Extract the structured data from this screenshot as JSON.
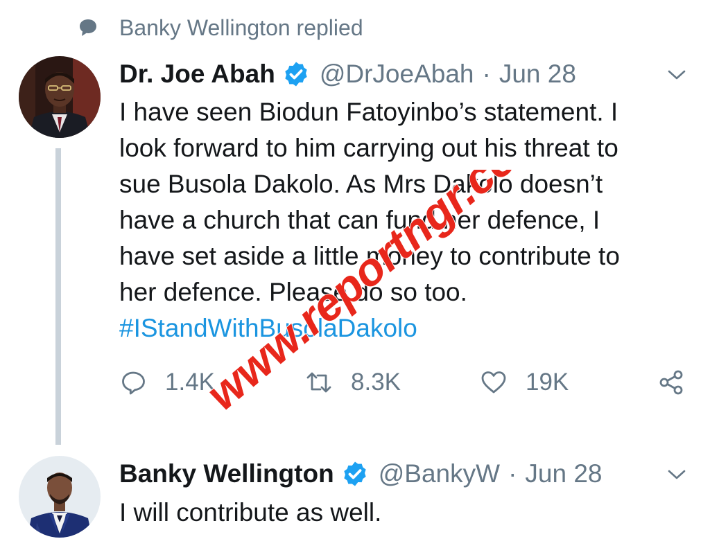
{
  "context": {
    "icon": "speech-bubble-icon",
    "text": "Banky Wellington replied"
  },
  "tweets": [
    {
      "author": {
        "name": "Dr. Joe Abah",
        "verified": true,
        "handle": "@DrJoeAbah"
      },
      "date": "Jun 28",
      "separator": "·",
      "lines": [
        "I have seen Biodun Fatoyinbo’s statement. I",
        "look forward to him carrying out his threat to",
        "sue Busola Dakolo. As Mrs Dakolo doesn’t",
        "have a church that can fund her defence, I",
        "have set aside a little money to contribute to",
        "her defence. Please do so too."
      ],
      "hashtag": "#IStandWithBusolaDakolo",
      "actions": {
        "reply_count": "1.4K",
        "retweet_count": "8.3K",
        "like_count": "19K"
      }
    },
    {
      "author": {
        "name": "Banky Wellington",
        "verified": true,
        "handle": "@BankyW"
      },
      "date": "Jun 28",
      "separator": "·",
      "lines": [
        "I will contribute as well."
      ]
    }
  ],
  "watermark": {
    "text": "www.reportngr.com"
  },
  "colors": {
    "text": "#14171a",
    "secondary": "#657786",
    "link": "#1b95e0",
    "verified": "#1da1f2",
    "thread_line": "#c9d2da",
    "watermark": "#e8271b"
  }
}
